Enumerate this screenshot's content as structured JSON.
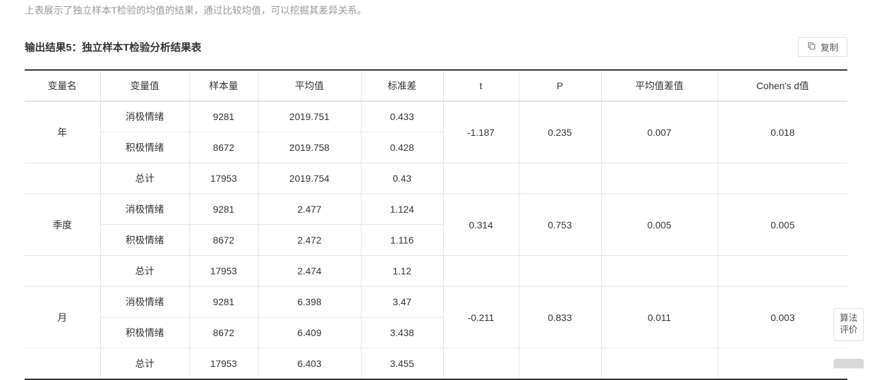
{
  "intro_text": "上表展示了独立样本T检验的均值的结果，通过比较均值，可以挖掘其差异关系。",
  "section_title": "输出结果5：独立样本T检验分析结果表",
  "copy_label": "复制",
  "eval_label": "算法评价",
  "headers": {
    "varname": "变量名",
    "varval": "变量值",
    "n": "样本量",
    "mean": "平均值",
    "std": "标准差",
    "t": "t",
    "p": "P",
    "diff": "平均值差值",
    "cohen": "Cohen's d值"
  },
  "labels": {
    "neg": "消极情绪",
    "pos": "积极情绪",
    "total": "总计"
  },
  "groups": [
    {
      "varname": "年",
      "neg": {
        "n": "9281",
        "mean": "2019.751",
        "std": "0.433"
      },
      "pos": {
        "n": "8672",
        "mean": "2019.758",
        "std": "0.428"
      },
      "total": {
        "n": "17953",
        "mean": "2019.754",
        "std": "0.43"
      },
      "t": "-1.187",
      "p": "0.235",
      "diff": "0.007",
      "cohen": "0.018"
    },
    {
      "varname": "季度",
      "neg": {
        "n": "9281",
        "mean": "2.477",
        "std": "1.124"
      },
      "pos": {
        "n": "8672",
        "mean": "2.472",
        "std": "1.116"
      },
      "total": {
        "n": "17953",
        "mean": "2.474",
        "std": "1.12"
      },
      "t": "0.314",
      "p": "0.753",
      "diff": "0.005",
      "cohen": "0.005"
    },
    {
      "varname": "月",
      "neg": {
        "n": "9281",
        "mean": "6.398",
        "std": "3.47"
      },
      "pos": {
        "n": "8672",
        "mean": "6.409",
        "std": "3.438"
      },
      "total": {
        "n": "17953",
        "mean": "6.403",
        "std": "3.455"
      },
      "t": "-0.211",
      "p": "0.833",
      "diff": "0.011",
      "cohen": "0.003"
    }
  ]
}
